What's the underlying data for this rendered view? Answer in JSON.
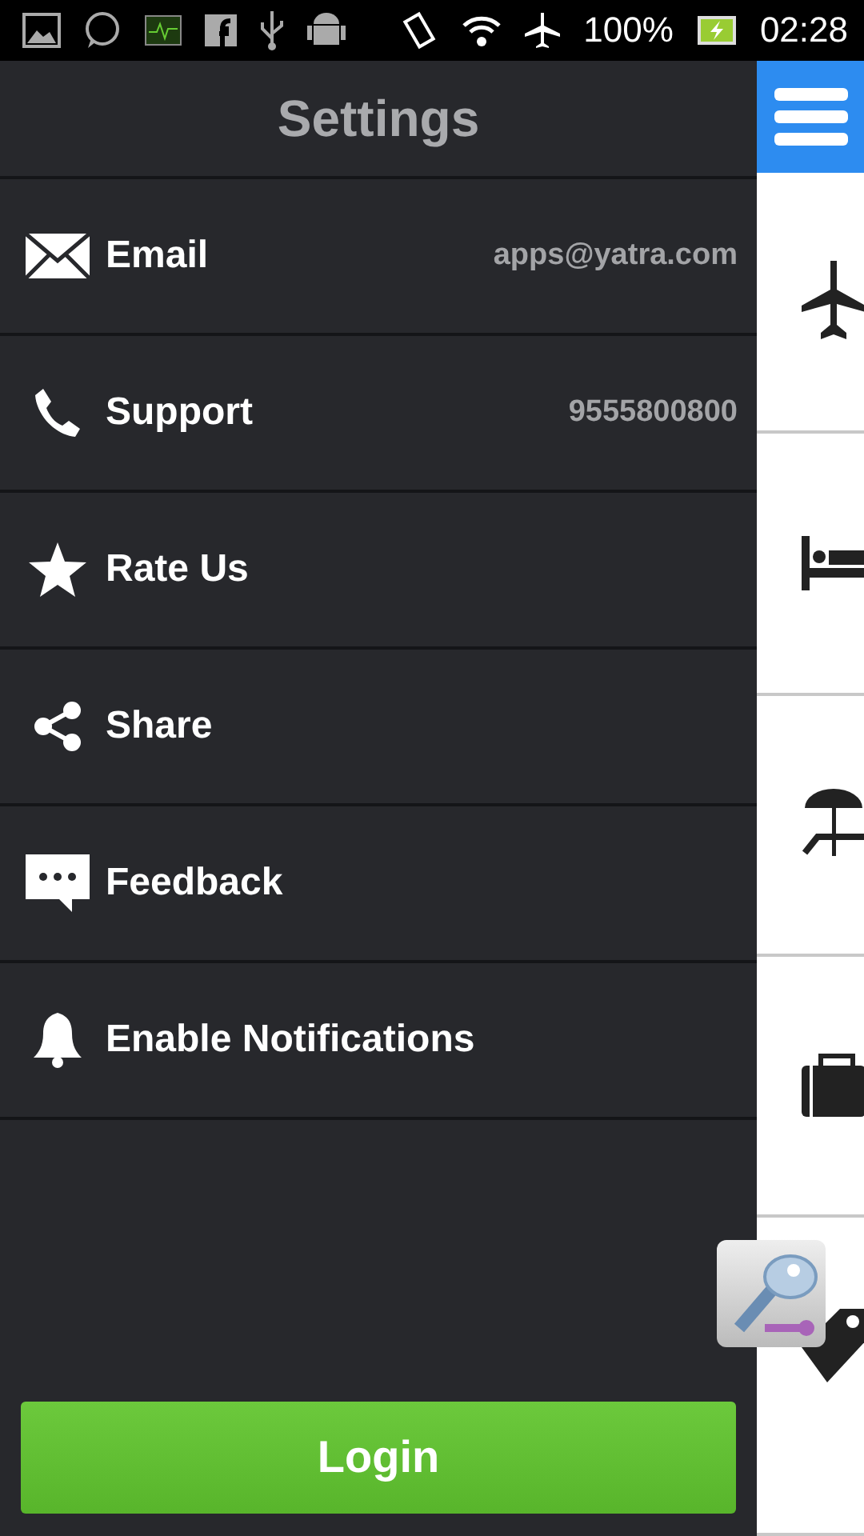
{
  "status_bar": {
    "battery": "100%",
    "time": "02:28"
  },
  "drawer": {
    "title": "Settings",
    "items": [
      {
        "kind": "email",
        "label": "Email",
        "value": "apps@yatra.com"
      },
      {
        "kind": "phone",
        "label": "Support",
        "value": "9555800800"
      },
      {
        "kind": "star",
        "label": "Rate Us"
      },
      {
        "kind": "share",
        "label": "Share"
      },
      {
        "kind": "feedback",
        "label": "Feedback"
      },
      {
        "kind": "bell",
        "label": "Enable Notifications"
      }
    ],
    "login_button": "Login"
  }
}
